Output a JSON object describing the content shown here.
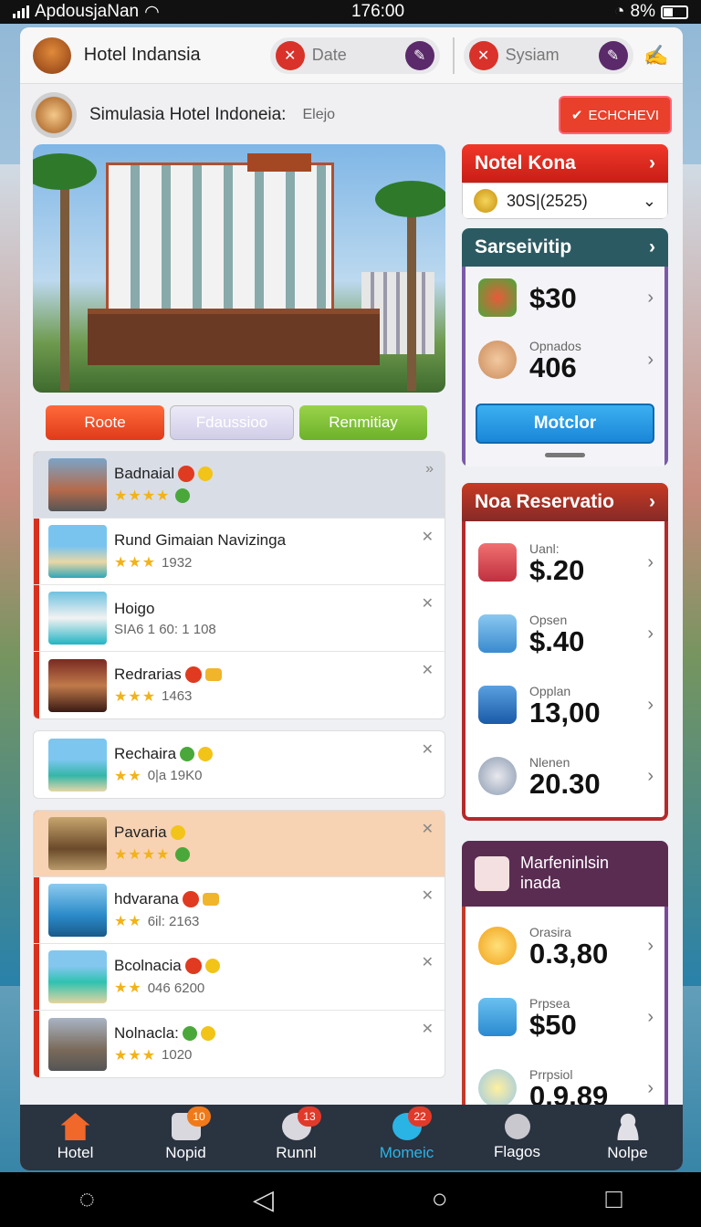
{
  "status": {
    "carrier": "ApdousjaNan",
    "time": "176:00",
    "battery": "8%"
  },
  "header": {
    "title": "Hotel Indansia",
    "date_label": "Date",
    "system_label": "Sysiam"
  },
  "subheader": {
    "title": "Simulasia Hotel Indoneia:",
    "extra": "Elejo",
    "check_label": "ECHCHEVI"
  },
  "filter_tabs": [
    "Roote",
    "Fdaussioo",
    "Renmitiay"
  ],
  "hotel_groups": [
    [
      {
        "name": "Badnaial",
        "meta": "",
        "stars": "★★★★"
      },
      {
        "name": "Rund Gimaian Navizinga",
        "meta": "1932",
        "stars": "★★★"
      },
      {
        "name": "Hoigo",
        "meta": "SIA6 1 60: 1 108",
        "stars": ""
      },
      {
        "name": "Redrarias",
        "meta": "1463",
        "stars": "★★★"
      }
    ],
    [
      {
        "name": "Rechaira",
        "meta": "0|a 19K0",
        "stars": "★★"
      }
    ],
    [
      {
        "name": "Pavaria",
        "meta": "",
        "stars": "★★★★"
      },
      {
        "name": "hdvarana",
        "meta": "6il: 2163",
        "stars": "★★"
      },
      {
        "name": "Bcolnacia",
        "meta": "046 6200",
        "stars": "★★"
      },
      {
        "name": "Nolnacla:",
        "meta": "1020",
        "stars": "★★★"
      }
    ]
  ],
  "hotel_card": {
    "title": "Notel Kona",
    "dropdown": "30S|(2525)"
  },
  "service_card": {
    "title": "Sarseivitip",
    "items": [
      {
        "label": "",
        "value": "$30"
      },
      {
        "label": "Opnados",
        "value": "406"
      }
    ],
    "button": "Motclor"
  },
  "reservation_card": {
    "title": "Noa Reservatio",
    "items": [
      {
        "label": "Uanl:",
        "value": "$.20"
      },
      {
        "label": "Opsen",
        "value": "$.40"
      },
      {
        "label": "Opplan",
        "value": "13,00"
      },
      {
        "label": "Nlenen",
        "value": "20.30"
      }
    ]
  },
  "maintenance_card": {
    "title": "Marfeninlsin inada",
    "items": [
      {
        "label": "Orasira",
        "value": "0.3,80"
      },
      {
        "label": "Prpsea",
        "value": "$50"
      },
      {
        "label": "Prrpsiol",
        "value": "0.9,89"
      }
    ]
  },
  "bottom_nav": [
    {
      "label": "Hotel",
      "badge": ""
    },
    {
      "label": "Nopid",
      "badge": "10"
    },
    {
      "label": "Runnl",
      "badge": "13"
    },
    {
      "label": "Momeic",
      "badge": "22"
    },
    {
      "label": "Flagos",
      "badge": ""
    },
    {
      "label": "Nolpe",
      "badge": ""
    }
  ],
  "colors": {
    "accent_red": "#d9301e",
    "nav_active": "#2ab4e6",
    "button_blue": "#1b86d8"
  }
}
